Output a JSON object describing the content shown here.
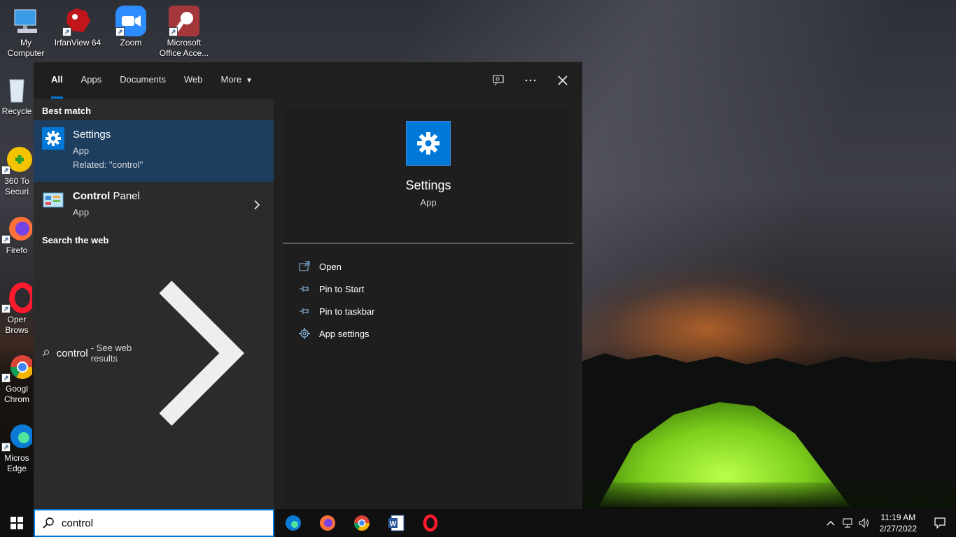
{
  "desktop": {
    "icons": [
      {
        "label": "My\nComputer",
        "icon": "computer-icon"
      },
      {
        "label": "IrfanView 64",
        "icon": "irfanview-icon"
      },
      {
        "label": "Zoom",
        "icon": "zoom-icon"
      },
      {
        "label": "Microsoft\nOffice Acce...",
        "icon": "access-icon"
      },
      {
        "label": "Recycle",
        "icon": "recycle-bin-icon"
      },
      {
        "label": "360 To\nSecuri",
        "icon": "360-security-icon"
      },
      {
        "label": "Firefo",
        "icon": "firefox-icon"
      },
      {
        "label": "Oper\nBrows",
        "icon": "opera-icon"
      },
      {
        "label": "Googl\nChrom",
        "icon": "chrome-icon"
      },
      {
        "label": "Micros\nEdge",
        "icon": "edge-icon"
      }
    ]
  },
  "search": {
    "tabs": [
      "All",
      "Apps",
      "Documents",
      "Web",
      "More"
    ],
    "active_tab": "All",
    "best_match_header": "Best match",
    "results": [
      {
        "name": "Settings",
        "type": "App",
        "related": "Related: \"control\"",
        "icon": "settings-gear-icon"
      },
      {
        "name_bold": "Control",
        "name_rest": " Panel",
        "type": "App",
        "icon": "control-panel-icon"
      }
    ],
    "web_header": "Search the web",
    "web_query": "control",
    "web_suffix": "- See web results",
    "preview": {
      "title": "Settings",
      "subtitle": "App",
      "actions": [
        {
          "label": "Open",
          "icon": "open-icon"
        },
        {
          "label": "Pin to Start",
          "icon": "pin-icon"
        },
        {
          "label": "Pin to taskbar",
          "icon": "pin-icon"
        },
        {
          "label": "App settings",
          "icon": "gear-icon"
        }
      ]
    },
    "input_value": "control"
  },
  "taskbar": {
    "apps": [
      "edge-icon",
      "firefox-icon",
      "chrome-icon",
      "word-icon",
      "opera-icon"
    ],
    "time": "11:19 AM",
    "date": "2/27/2022"
  },
  "colors": {
    "accent": "#0078d7",
    "selected_bg": "#1d3e5f",
    "panel_bg": "#202020"
  }
}
